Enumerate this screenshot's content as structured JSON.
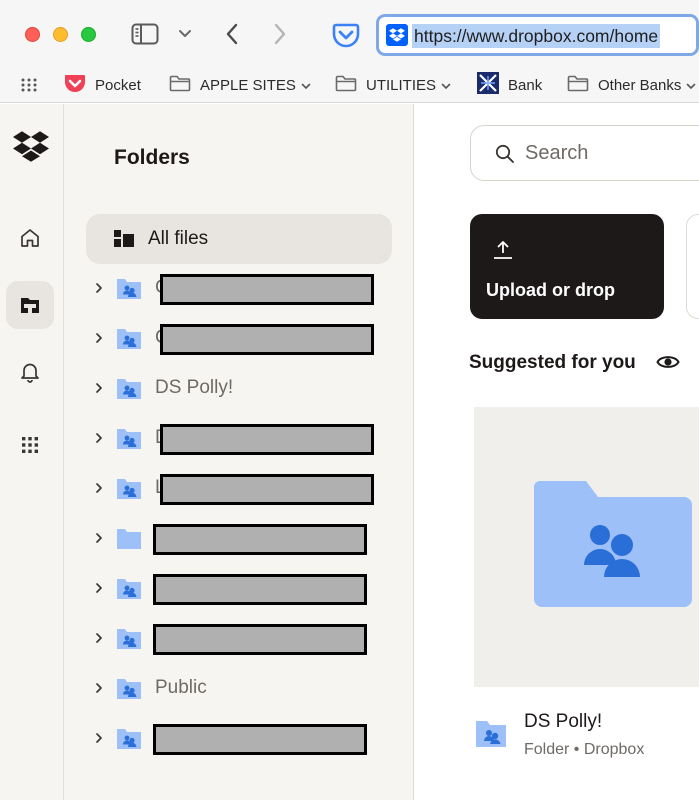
{
  "browser": {
    "url": "https://www.dropbox.com/home",
    "bookmarks": [
      {
        "label": "Pocket",
        "icon": "pocket-icon"
      },
      {
        "label": "APPLE SITES",
        "icon": "folder-icon",
        "has_menu": true
      },
      {
        "label": "UTILITIES",
        "icon": "folder-icon",
        "has_menu": true
      },
      {
        "label": "Bank",
        "icon": "bank-icon"
      },
      {
        "label": "Other Banks",
        "icon": "folder-icon",
        "has_menu": true
      }
    ]
  },
  "rail": {
    "items": [
      "home-icon",
      "files-icon",
      "bell-icon",
      "apps-grid-icon"
    ],
    "active": "files-icon"
  },
  "folders": {
    "title": "Folders",
    "all_files_label": "All files",
    "items": [
      {
        "label": "",
        "first_letter": "C",
        "redacted": true,
        "shared": true
      },
      {
        "label": "",
        "first_letter": "C",
        "redacted": true,
        "shared": true
      },
      {
        "label": "DS Polly!",
        "redacted": false,
        "shared": true
      },
      {
        "label": "",
        "first_letter": "D",
        "redacted": true,
        "shared": true
      },
      {
        "label": "",
        "first_letter": "L",
        "redacted": true,
        "shared": true
      },
      {
        "label": "",
        "redacted": true,
        "shared": false
      },
      {
        "label": "",
        "redacted": true,
        "shared": true
      },
      {
        "label": "",
        "redacted": true,
        "shared": true
      },
      {
        "label": "Public",
        "redacted": false,
        "shared": true
      },
      {
        "label": "",
        "redacted": true,
        "shared": true
      }
    ]
  },
  "main": {
    "search_placeholder": "Search",
    "upload_label": "Upload or drop",
    "suggested_title": "Suggested for you",
    "suggested_item": {
      "name": "DS Polly!",
      "meta": "Folder • Dropbox"
    }
  },
  "colors": {
    "accent": "#0061fe",
    "folder_blue": "#9cc0f7",
    "folder_people": "#2a6ed8",
    "panel_bg": "#f7f5f2",
    "upload_bg": "#1e1919"
  }
}
